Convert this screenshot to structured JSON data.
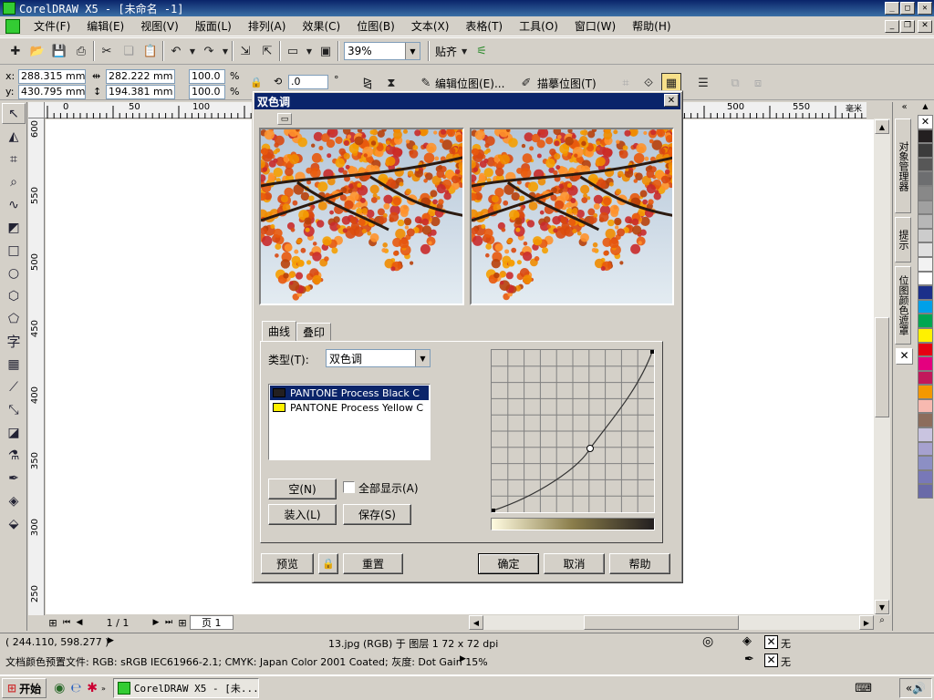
{
  "window": {
    "title": "CorelDRAW X5 - [未命名 -1]",
    "min": "_",
    "max": "□",
    "close": "✕"
  },
  "menu": [
    "文件(F)",
    "编辑(E)",
    "视图(V)",
    "版面(L)",
    "排列(A)",
    "效果(C)",
    "位图(B)",
    "文本(X)",
    "表格(T)",
    "工具(O)",
    "窗口(W)",
    "帮助(H)"
  ],
  "toolbar": {
    "zoom": "39%",
    "snap": "贴齐"
  },
  "props": {
    "x_label": "x:",
    "x": "288.315 mm",
    "y_label": "y:",
    "y": "430.795 mm",
    "w": "282.222 mm",
    "h": "194.381 mm",
    "sx": "100.0",
    "sy": "100.0",
    "pct": "%",
    "rot": ".0",
    "deg": "°",
    "edit_bitmap": "编辑位图(E)...",
    "trace_bitmap": "描摹位图(T)"
  },
  "ruler": {
    "h_ticks": [
      "0",
      "50",
      "100",
      "500",
      "550"
    ],
    "h_unit": "毫米",
    "v_ticks": [
      "600",
      "550",
      "500",
      "450",
      "400",
      "350",
      "300",
      "250"
    ]
  },
  "pagenav": {
    "count": "1 / 1",
    "page_tab": "页 1"
  },
  "docker": {
    "tab1": "对象管理器",
    "tab2": "提示",
    "tab3": "位图颜色遮罩"
  },
  "palette": [
    "#ffffff",
    "#231f20",
    "#3c3c3c",
    "#575757",
    "#6d6e70",
    "#888888",
    "#a0a0a0",
    "#b7b7b7",
    "#cccccc",
    "#e0e0e0",
    "#f2f2f2",
    "#ffffff",
    "#1b2f8a",
    "#00a0e9",
    "#00a651",
    "#fff100",
    "#e60012",
    "#e4007f",
    "#c2185b",
    "#f39800",
    "#f7b9b0",
    "#8c6d5c",
    "#c9c4e0",
    "#a6a1cf",
    "#8c8fc4",
    "#7878b8",
    "#6a6aa8"
  ],
  "status": {
    "coords": "( 244.110, 598.277 )",
    "info": "13.jpg (RGB) 于 图层 1 72 x 72 dpi",
    "fill": "无",
    "outline": "无",
    "profile": "文档颜色预置文件: RGB: sRGB IEC61966-2.1; CMYK: Japan Color 2001 Coated; 灰度: Dot Gain 15%"
  },
  "taskbar": {
    "start": "开始",
    "task": "CorelDRAW X5 - [未..."
  },
  "dialog": {
    "title": "双色调",
    "tabs": [
      "曲线",
      "叠印"
    ],
    "type_label": "类型(T):",
    "type_value": "双色调",
    "inks": [
      {
        "name": "PANTONE Process Black C",
        "color": "#231f20"
      },
      {
        "name": "PANTONE Process Yellow C",
        "color": "#fff100"
      }
    ],
    "btn_empty": "空(N)",
    "show_all": "全部显示(A)",
    "btn_load": "装入(L)",
    "btn_save": "保存(S)",
    "btn_preview": "预览",
    "btn_reset": "重置",
    "btn_ok": "确定",
    "btn_cancel": "取消",
    "btn_help": "帮助"
  }
}
